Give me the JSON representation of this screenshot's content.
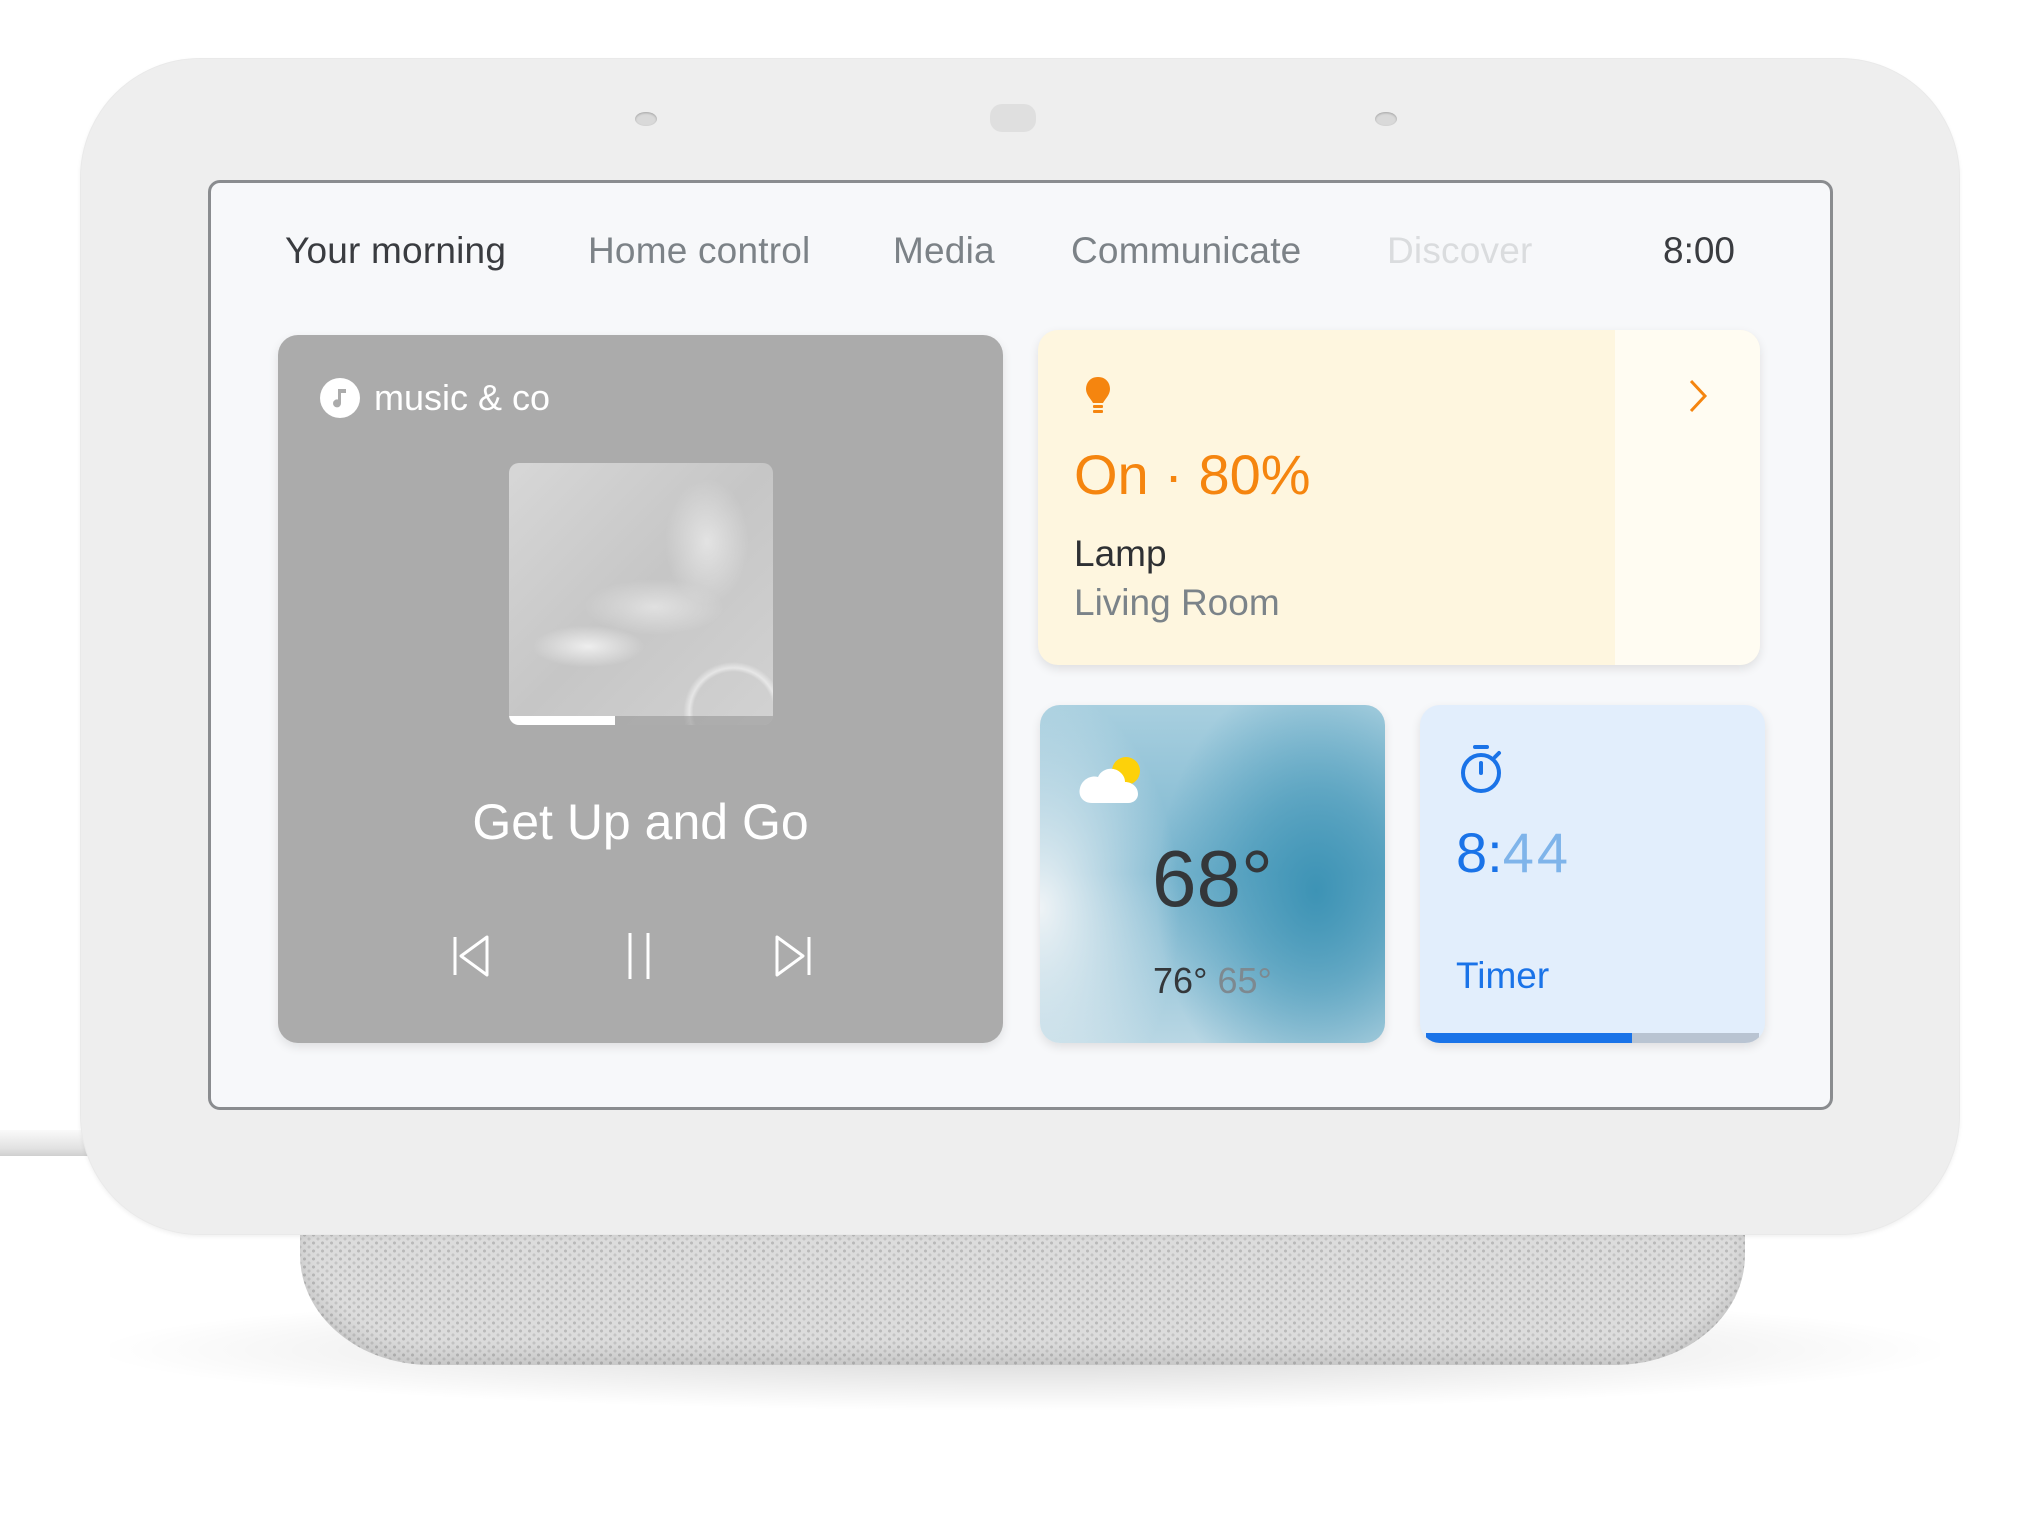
{
  "device": {
    "name": "Smart display",
    "colors": {
      "bezel": "#eeeeee",
      "screen_bg": "#f7f8fa"
    }
  },
  "nav": {
    "tabs": [
      {
        "label": "Your morning",
        "state": "active"
      },
      {
        "label": "Home control",
        "state": "inactive"
      },
      {
        "label": "Media",
        "state": "inactive"
      },
      {
        "label": "Communicate",
        "state": "inactive"
      },
      {
        "label": "Discover",
        "state": "faded"
      }
    ],
    "clock": "8:00"
  },
  "media_card": {
    "source_icon": "music-note-icon",
    "source": "music & co",
    "track_title": "Get Up and Go",
    "progress_fraction": 0.4,
    "controls": [
      {
        "icon": "skip-previous-icon",
        "label": "Previous"
      },
      {
        "icon": "pause-icon",
        "label": "Pause"
      },
      {
        "icon": "skip-next-icon",
        "label": "Next"
      }
    ],
    "colors": {
      "background": "#ababab",
      "text": "#ffffff"
    }
  },
  "lamp_card": {
    "icon": "lightbulb-icon",
    "state": "On · 80%",
    "brightness_percent": 80,
    "device": "Lamp",
    "room": "Living Room",
    "chevron_icon": "chevron-right-icon",
    "colors": {
      "accent": "#f5850f",
      "background": "#fef6df"
    }
  },
  "weather_card": {
    "icon": "partly-cloudy-icon",
    "current": "68°",
    "high": "76°",
    "low": "65°"
  },
  "timer_card": {
    "icon": "stopwatch-icon",
    "minutes": "8:",
    "seconds": "44",
    "label": "Timer",
    "progress_fraction": 0.62,
    "colors": {
      "accent": "#1a73e8",
      "background": "#e2eefc"
    }
  }
}
